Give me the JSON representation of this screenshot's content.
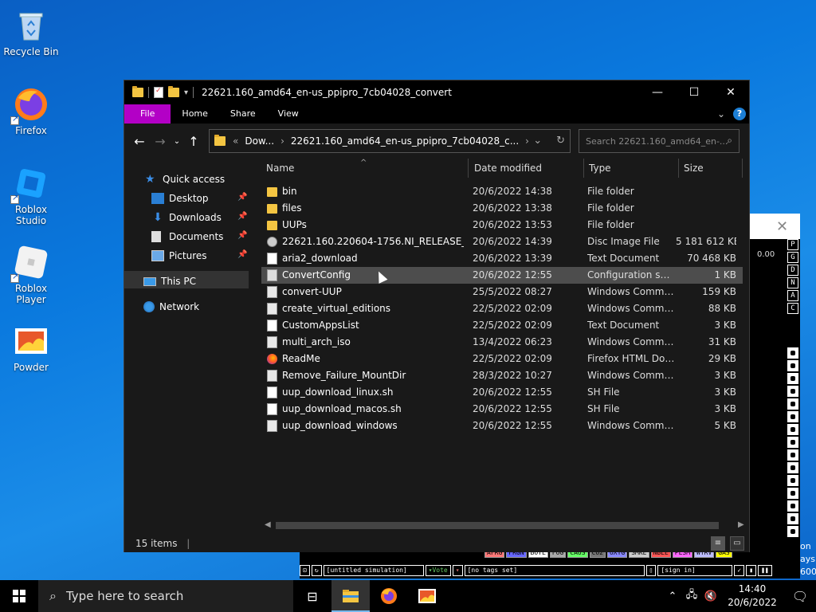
{
  "desktop": {
    "icons": [
      {
        "label": "Recycle Bin",
        "icon": "recycle-bin-icon"
      },
      {
        "label": "Firefox",
        "icon": "firefox-icon"
      },
      {
        "label": "Roblox Studio",
        "icon": "roblox-studio-icon"
      },
      {
        "label": "Roblox Player",
        "icon": "roblox-player-icon"
      },
      {
        "label": "Powder",
        "icon": "powder-icon"
      }
    ]
  },
  "powder": {
    "readout": "0.00",
    "side_buttons": [
      "P",
      "G",
      "D",
      "N",
      "A",
      "C"
    ],
    "elements": [
      "AFRG",
      "FRGN",
      "BOYL",
      "FOG",
      "CAUS",
      "CO2",
      "OXYG",
      "SMKE",
      "NBLE",
      "PLSM",
      "WTRV",
      "GAS"
    ],
    "element_colors": [
      "#ff7777",
      "#6666ff",
      "#ffffff",
      "#aaaaaa",
      "#66ff66",
      "#777777",
      "#8888ff",
      "#cccccc",
      "#ff5555",
      "#ff66ff",
      "#bbbbff",
      "#ffff00"
    ],
    "bottom": {
      "sim_name": "[untitled simulation]",
      "vote": "Vote",
      "tags": "[no tags set]",
      "signin": "[sign in]"
    },
    "edge_text": [
      "on",
      "ays",
      "600"
    ]
  },
  "explorer": {
    "title": "22621.160_amd64_en-us_ppipro_7cb04028_convert",
    "ribbon_tabs": [
      "File",
      "Home",
      "Share",
      "View"
    ],
    "address": {
      "parts": [
        "Dow...",
        "22621.160_amd64_en-us_ppipro_7cb04028_c..."
      ]
    },
    "search_placeholder": "Search 22621.160_amd64_en-...",
    "nav": {
      "quick_access": "Quick access",
      "desktop": "Desktop",
      "downloads": "Downloads",
      "documents": "Documents",
      "pictures": "Pictures",
      "this_pc": "This PC",
      "network": "Network"
    },
    "columns": {
      "name": "Name",
      "date": "Date modified",
      "type": "Type",
      "size": "Size"
    },
    "files": [
      {
        "name": "bin",
        "date": "20/6/2022 14:38",
        "type": "File folder",
        "size": "",
        "icon": "folder-icon"
      },
      {
        "name": "files",
        "date": "20/6/2022 13:38",
        "type": "File folder",
        "size": "",
        "icon": "folder-icon"
      },
      {
        "name": "UUPs",
        "date": "20/6/2022 13:53",
        "type": "File folder",
        "size": "",
        "icon": "folder-icon"
      },
      {
        "name": "22621.160.220604-1756.NI_RELEASE_SVC_...",
        "date": "20/6/2022 14:39",
        "type": "Disc Image File",
        "size": "5 181 612 KB",
        "icon": "disc-image-icon"
      },
      {
        "name": "aria2_download",
        "date": "20/6/2022 13:39",
        "type": "Text Document",
        "size": "70 468 KB",
        "icon": "text-file-icon"
      },
      {
        "name": "ConvertConfig",
        "date": "20/6/2022 12:55",
        "type": "Configuration sett...",
        "size": "1 KB",
        "icon": "config-file-icon"
      },
      {
        "name": "convert-UUP",
        "date": "25/5/2022 08:27",
        "type": "Windows Comma...",
        "size": "159 KB",
        "icon": "cmd-file-icon"
      },
      {
        "name": "create_virtual_editions",
        "date": "22/5/2022 02:09",
        "type": "Windows Comma...",
        "size": "88 KB",
        "icon": "cmd-file-icon"
      },
      {
        "name": "CustomAppsList",
        "date": "22/5/2022 02:09",
        "type": "Text Document",
        "size": "3 KB",
        "icon": "text-file-icon"
      },
      {
        "name": "multi_arch_iso",
        "date": "13/4/2022 06:23",
        "type": "Windows Comma...",
        "size": "31 KB",
        "icon": "cmd-file-icon"
      },
      {
        "name": "ReadMe",
        "date": "22/5/2022 02:09",
        "type": "Firefox HTML Doc...",
        "size": "29 KB",
        "icon": "firefox-html-icon"
      },
      {
        "name": "Remove_Failure_MountDir",
        "date": "28/3/2022 10:27",
        "type": "Windows Comma...",
        "size": "3 KB",
        "icon": "cmd-file-icon"
      },
      {
        "name": "uup_download_linux.sh",
        "date": "20/6/2022 12:55",
        "type": "SH File",
        "size": "3 KB",
        "icon": "text-file-icon"
      },
      {
        "name": "uup_download_macos.sh",
        "date": "20/6/2022 12:55",
        "type": "SH File",
        "size": "3 KB",
        "icon": "text-file-icon"
      },
      {
        "name": "uup_download_windows",
        "date": "20/6/2022 12:55",
        "type": "Windows Comma...",
        "size": "5 KB",
        "icon": "cmd-file-icon"
      }
    ],
    "selected_index": 5,
    "status": "15 items"
  },
  "taskbar": {
    "search_placeholder": "Type here to search",
    "time": "14:40",
    "date": "20/6/2022"
  }
}
